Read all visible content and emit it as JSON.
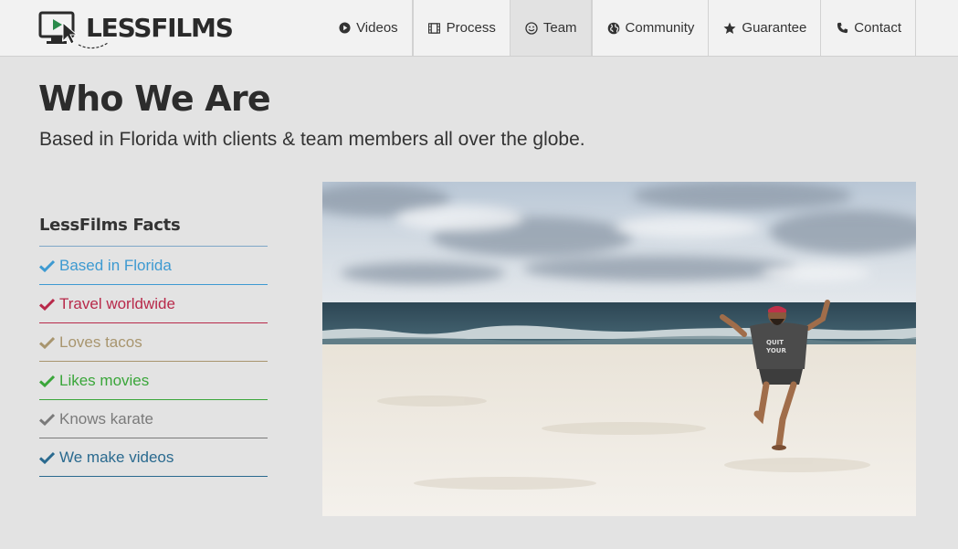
{
  "brand": {
    "name": "LESSFILMS"
  },
  "nav": [
    {
      "label": "Videos",
      "icon": "play-circle-icon"
    },
    {
      "label": "Process",
      "icon": "film-icon"
    },
    {
      "label": "Team",
      "icon": "smile-icon",
      "active": true
    },
    {
      "label": "Community",
      "icon": "globe-icon"
    },
    {
      "label": "Guarantee",
      "icon": "star-icon"
    },
    {
      "label": "Contact",
      "icon": "phone-icon"
    }
  ],
  "hero": {
    "title": "Who We Are",
    "subtitle": "Based in Florida with clients & team members all over the globe."
  },
  "facts": {
    "title": "LessFilms Facts",
    "items": [
      {
        "label": "Based in Florida",
        "color": "#3d9ad1"
      },
      {
        "label": "Travel worldwide",
        "color": "#b8294a"
      },
      {
        "label": "Loves tacos",
        "color": "#a8956e"
      },
      {
        "label": "Likes movies",
        "color": "#3aa63a"
      },
      {
        "label": "Knows karate",
        "color": "#7a7a7a"
      },
      {
        "label": "We make videos",
        "color": "#2a6a8f"
      }
    ]
  },
  "colors": {
    "background": "#e3e3e3",
    "header": "#f2f2f2",
    "accent": "#7fa7c7"
  }
}
